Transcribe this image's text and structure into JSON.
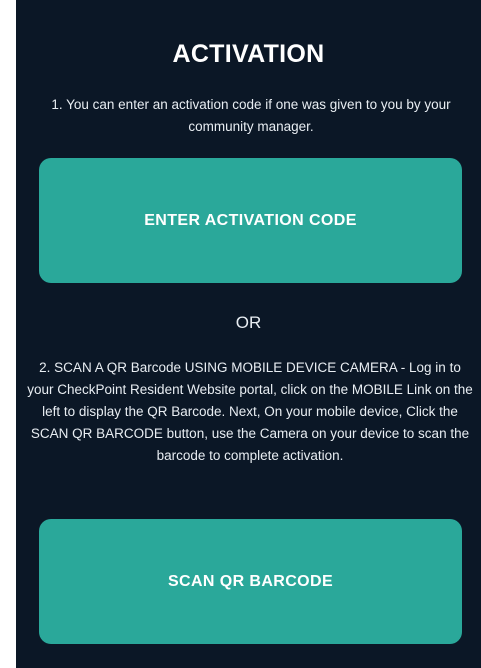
{
  "screen": {
    "title": "ACTIVATION",
    "instruction_1": "1. You can enter an activation code if one was given to you by your community manager.",
    "enter_code_button": "ENTER ACTIVATION CODE",
    "or_separator": "OR",
    "instruction_2": "2. SCAN A QR Barcode USING MOBILE DEVICE CAMERA - Log in to your CheckPoint Resident Website portal, click on the MOBILE Link on the left to display the QR Barcode. Next, On your mobile device, Click the SCAN QR BARCODE button, use the Camera on your device to scan the barcode to complete activation.",
    "scan_button": "SCAN QR BARCODE"
  },
  "colors": {
    "background": "#0b1726",
    "button": "#2aa89a",
    "text": "#ffffff"
  }
}
